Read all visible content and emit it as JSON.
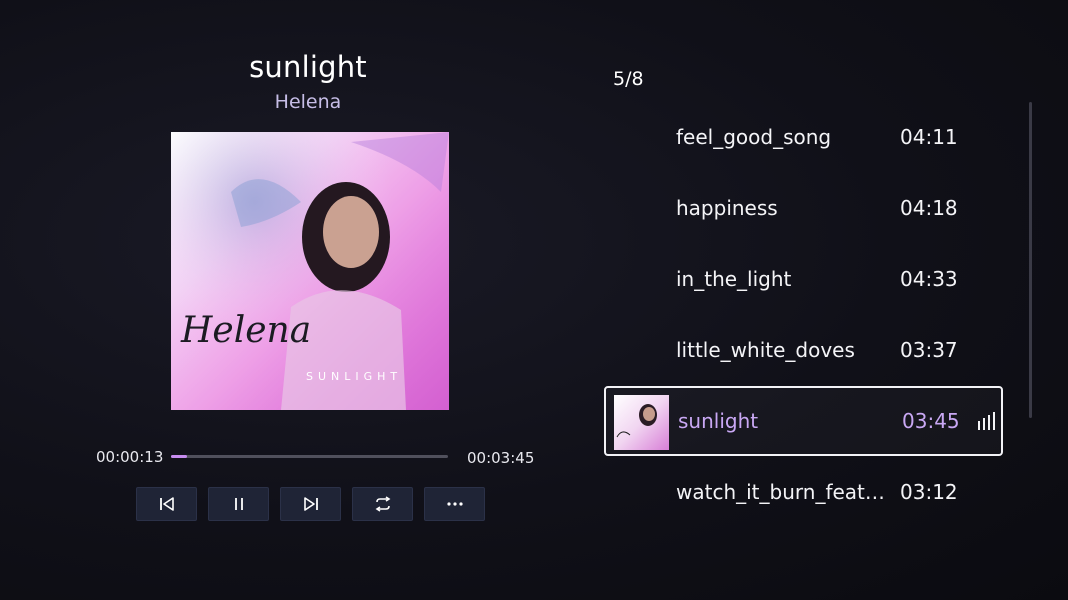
{
  "now_playing": {
    "title": "sunlight",
    "artist": "Helena",
    "cover_text": "Helena",
    "cover_subtext": "SUNLIGHT",
    "current_time": "00:00:13",
    "total_time": "00:03:45",
    "progress_fraction": 0.058
  },
  "controls": [
    {
      "name": "previous-button",
      "icon": "skip-previous-icon"
    },
    {
      "name": "pause-button",
      "icon": "pause-icon"
    },
    {
      "name": "next-button",
      "icon": "skip-next-icon"
    },
    {
      "name": "repeat-button",
      "icon": "repeat-icon"
    },
    {
      "name": "more-button",
      "icon": "more-horizontal-icon"
    }
  ],
  "playlist": {
    "counter": "5/8",
    "items": [
      {
        "name": "feel_good_song",
        "duration": "04:11"
      },
      {
        "name": "happiness",
        "duration": "04:18"
      },
      {
        "name": "in_the_light",
        "duration": "04:33"
      },
      {
        "name": "little_white_doves",
        "duration": "03:37"
      },
      {
        "name": "sunlight",
        "duration": "03:45",
        "active": true
      },
      {
        "name": "watch_it_burn_feat_…",
        "duration": "03:12"
      }
    ]
  },
  "colors": {
    "accent": "#c9a8f4",
    "progress": "#c78cf0",
    "button_bg": "#1f2436"
  }
}
